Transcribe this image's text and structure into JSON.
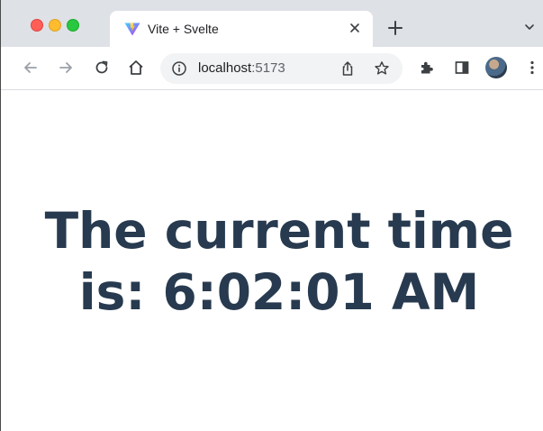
{
  "tab": {
    "title": "Vite + Svelte",
    "favicon": "vite-logo-icon",
    "close_icon": "close-icon"
  },
  "toolbar": {
    "url_host": "localhost",
    "url_port": ":5173",
    "icons": [
      "back-icon",
      "forward-icon",
      "reload-icon",
      "home-icon",
      "info-icon",
      "share-icon",
      "star-icon",
      "extensions-icon",
      "side-panel-icon",
      "avatar",
      "more-menu-icon"
    ]
  },
  "page": {
    "heading_line1": "The current time",
    "heading_line2": "is: 6:02:01 AM"
  },
  "colors": {
    "heading": "#273a4f",
    "tabstrip": "#dee1e6",
    "omnibox": "#f1f3f4"
  }
}
